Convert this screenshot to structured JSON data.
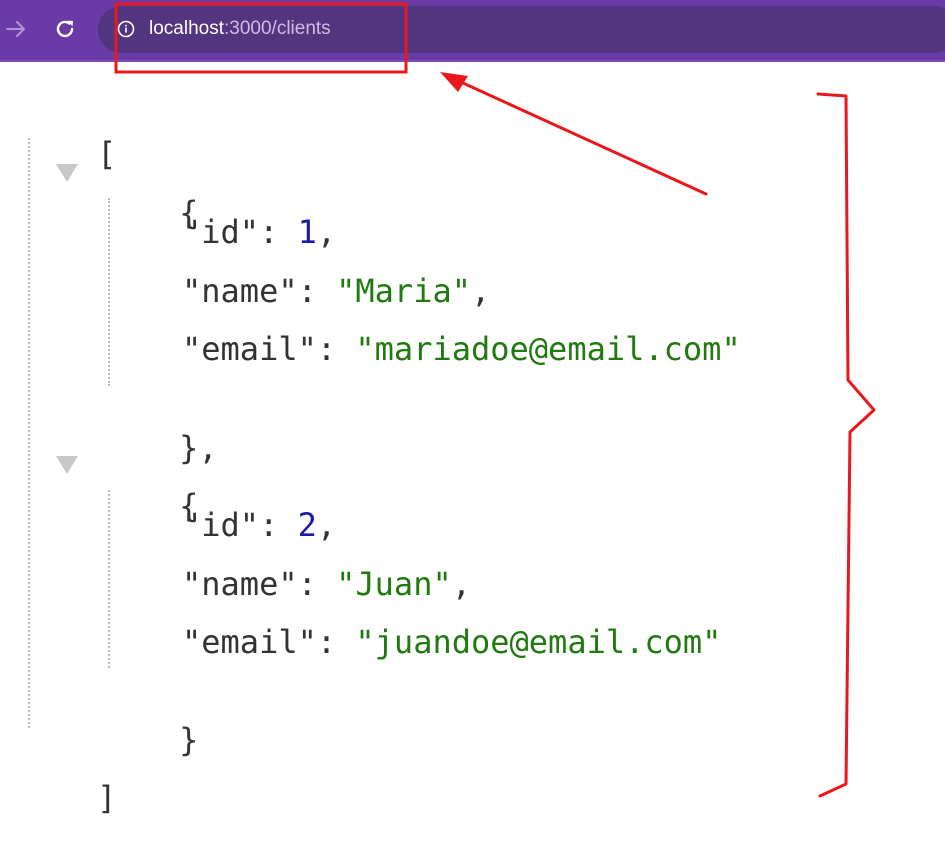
{
  "browser": {
    "url_host": "localhost",
    "url_path": ":3000/clients",
    "forward_icon": "arrow-right-icon",
    "reload_icon": "reload-icon",
    "info_icon": "info-icon",
    "accent": "#6a3aa7"
  },
  "json_view": {
    "open_bracket": "[",
    "close_bracket": "]",
    "items": [
      {
        "open": "{",
        "close": "},",
        "id_key": "\"id\"",
        "id_value": "1",
        "name_key": "\"name\"",
        "name_value": "\"Maria\"",
        "email_key": "\"email\"",
        "email_value": "\"mariadoe@email.com\""
      },
      {
        "open": "{",
        "close": "}",
        "id_key": "\"id\"",
        "id_value": "2",
        "name_key": "\"name\"",
        "name_value": "\"Juan\"",
        "email_key": "\"email\"",
        "email_value": "\"juandoe@email.com\""
      }
    ],
    "colors": {
      "key": "#333333",
      "number": "#1a1aa6",
      "string": "#207a10"
    }
  },
  "annotations": {
    "color": "#e8181c"
  }
}
